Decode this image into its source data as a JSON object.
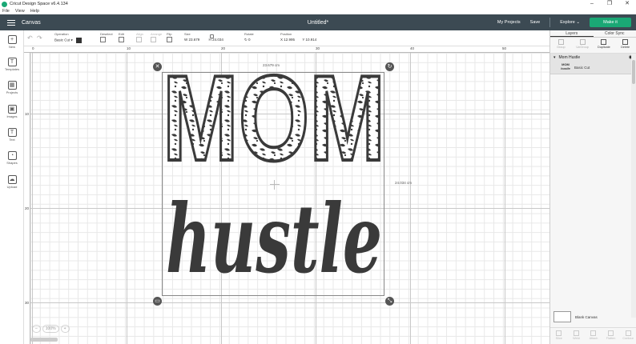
{
  "window": {
    "title": "Cricut Design Space  v6.4.134",
    "min": "–",
    "max": "❐",
    "close": "✕"
  },
  "menu": [
    "File",
    "View",
    "Help"
  ],
  "appbar": {
    "canvas_label": "Canvas",
    "doc_title": "Untitled*",
    "my_projects": "My Projects",
    "save": "Save",
    "explore": "Explore",
    "make": "Make it"
  },
  "toolbar": {
    "undo": "↶",
    "redo": "↷",
    "operation_label": "Operation",
    "operation_value": "Basic Cut",
    "deselect_label": "Deselect",
    "edit_label": "Edit",
    "align_label": "Align",
    "arrange_label": "Arrange",
    "flip_label": "Flip",
    "size_label": "Size",
    "size_w_label": "W",
    "size_w": "23.679",
    "size_h_label": "H",
    "size_h": "24.034",
    "rotate_label": "Rotate",
    "rotate_value": "0",
    "position_label": "Position",
    "pos_x_label": "X",
    "pos_x": "12.995",
    "pos_y_label": "Y",
    "pos_y": "10.914"
  },
  "sidebar": [
    {
      "label": "New",
      "glyph": "+"
    },
    {
      "label": "Templates",
      "glyph": "T"
    },
    {
      "label": "Projects",
      "glyph": "▦"
    },
    {
      "label": "Images",
      "glyph": "▣"
    },
    {
      "label": "Text",
      "glyph": "T"
    },
    {
      "label": "Shapes",
      "glyph": "◔"
    },
    {
      "label": "Upload",
      "glyph": "☁"
    }
  ],
  "rulers": {
    "top": [
      "0",
      "10",
      "20",
      "30",
      "40",
      "50"
    ],
    "left": [
      "10",
      "20",
      "30"
    ]
  },
  "canvas": {
    "width_readout": "23.679 cm",
    "height_readout": "24.034 cm",
    "design_top": "MOM",
    "design_bottom": "hustle",
    "zoom_minus": "–",
    "zoom_value": "100%",
    "zoom_plus": "+"
  },
  "panel": {
    "tab_layers": "Layers",
    "tab_color_sync": "Color Sync",
    "tools": [
      "Group",
      "UnGroup",
      "Duplicate",
      "Delete"
    ],
    "group_name": "Mom Hustle",
    "layer_thumb_top": "MOM",
    "layer_thumb_bottom": "hustle",
    "layer_name": "Basic Cut",
    "blank_canvas": "Blank Canvas",
    "bottom_tools": [
      "Slice",
      "Weld",
      "Attach",
      "Flatten",
      "Contour"
    ]
  },
  "colors": {
    "appbar": "#3c4a53",
    "make": "#1aa875",
    "design": "#3a3a3a"
  }
}
